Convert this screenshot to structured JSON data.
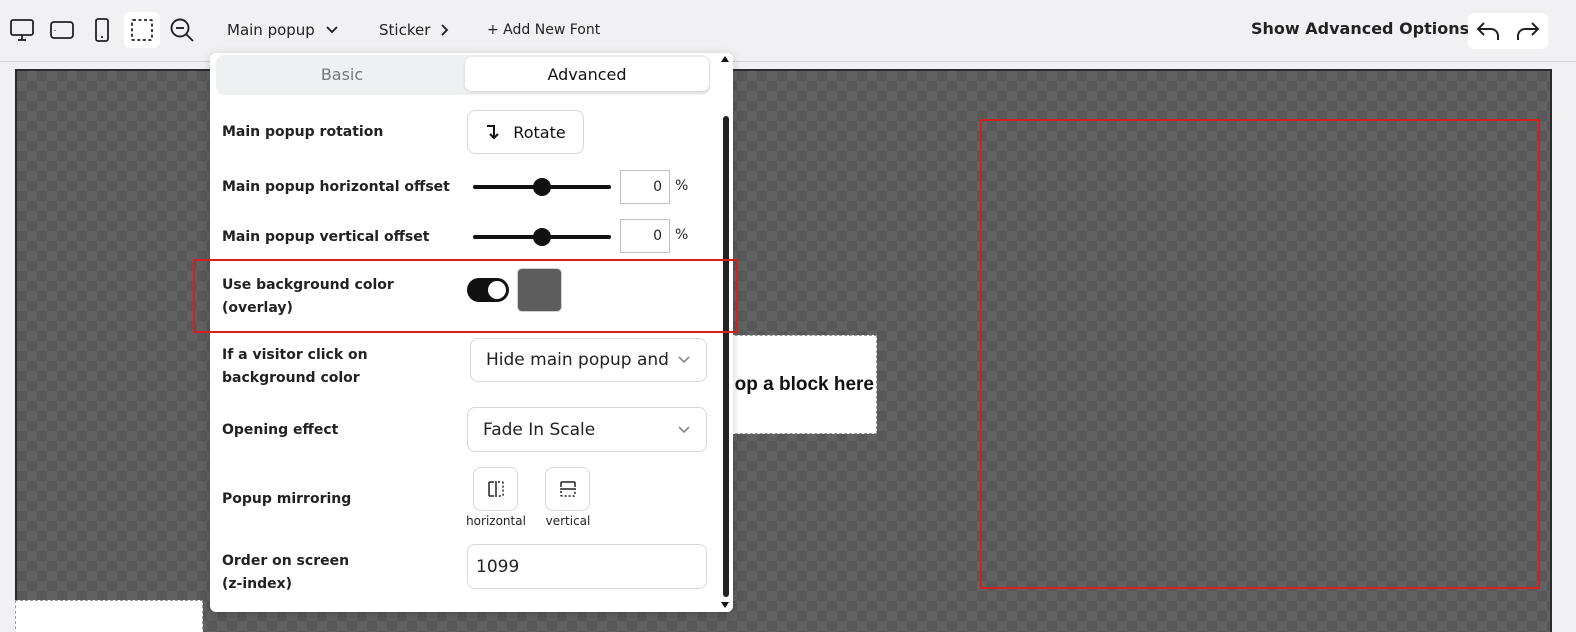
{
  "toolbar": {
    "device_icons": [
      "desktop-icon",
      "tablet-landscape-icon",
      "mobile-icon",
      "selection-icon",
      "zoom-out-icon"
    ],
    "main_popup_label": "Main popup",
    "sticker_label": "Sticker",
    "add_font_label": "+ Add New Font",
    "show_advanced_label": "Show Advanced Options",
    "undo_icon": "undo-icon",
    "redo_icon": "redo-icon"
  },
  "canvas": {
    "drop_block_text": "op a block here"
  },
  "panel": {
    "tabs": [
      {
        "label": "Basic",
        "active": false
      },
      {
        "label": "Advanced",
        "active": true
      }
    ],
    "rotation": {
      "label": "Main popup rotation",
      "button_label": "Rotate"
    },
    "horizontal_offset": {
      "label": "Main popup horizontal offset",
      "value": "0",
      "unit": "%",
      "slider_fraction": 0.5
    },
    "vertical_offset": {
      "label": "Main popup vertical offset",
      "value": "0",
      "unit": "%",
      "slider_fraction": 0.5
    },
    "background_color": {
      "label_line1": "Use background color",
      "label_line2": "(overlay)",
      "enabled": true,
      "color": "#5d5d5d"
    },
    "visitor_click": {
      "label_line1": "If a visitor click on",
      "label_line2": "background color",
      "value": "Hide main popup and"
    },
    "opening_effect": {
      "label": "Opening effect",
      "value": "Fade In Scale"
    },
    "mirroring": {
      "label": "Popup mirroring",
      "horizontal_label": "horizontal",
      "vertical_label": "vertical"
    },
    "z_index": {
      "label_line1": "Order on screen",
      "label_line2": "(z-index)",
      "value": "1099"
    }
  },
  "colors": {
    "accent": "#111111",
    "highlight": "#d32020",
    "toolbar_bg": "#f1f1f3"
  }
}
